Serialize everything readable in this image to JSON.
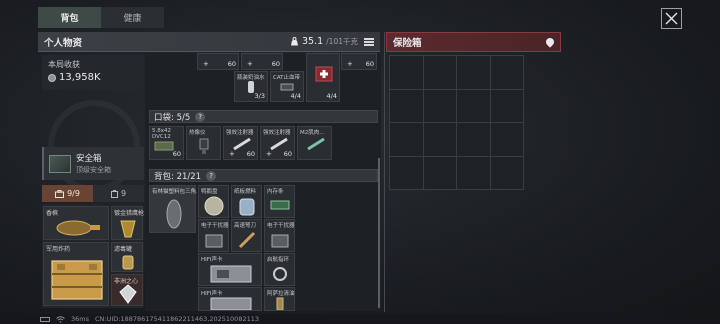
{
  "tabs": [
    {
      "label": "背包",
      "active": true
    },
    {
      "label": "健康",
      "active": false
    }
  ],
  "personal": {
    "title": "个人物资",
    "weight_current": "35.1",
    "weight_max": "/101千克"
  },
  "safe_box_panel": {
    "title": "保险箱"
  },
  "earnings": {
    "label": "本局收获",
    "value": "13,958K"
  },
  "safebox_item": {
    "name": "安全箱",
    "grade": "顶级安全箱"
  },
  "subtabs": [
    {
      "label": "9/9",
      "icon": "toolbox-icon",
      "active": true
    },
    {
      "label": "9",
      "icon": "bag-icon",
      "active": false
    }
  ],
  "equipment": [
    {
      "label": "香槟"
    },
    {
      "label": "镀金猎鹰枪"
    },
    {
      "label": "军用炸药"
    },
    {
      "label": "滤毒罐"
    },
    {
      "label": "非洲之心"
    }
  ],
  "top_items": [
    {
      "plus": "+",
      "count": "60"
    },
    {
      "plus": "+",
      "count": "60"
    },
    {
      "plus": "+",
      "count": "60"
    },
    {
      "name": "瓶装奶油水",
      "count": "3/3"
    },
    {
      "name": "CAT止血带",
      "count": "4/4"
    },
    {
      "name": "",
      "count": "4/4"
    }
  ],
  "pocket": {
    "label": "口袋: 5/5",
    "help": "?",
    "items": [
      {
        "name": "5.8x42\nDVC12",
        "count": "60"
      },
      {
        "name": "热像仪",
        "count": ""
      },
      {
        "name": "强效注射器",
        "plus": "+",
        "count": "60"
      },
      {
        "name": "强效注射器",
        "plus": "+",
        "count": "60"
      },
      {
        "name": "M2肌肉...",
        "count": ""
      }
    ]
  },
  "backpack": {
    "label": "背包: 21/21",
    "help": "?",
    "items": [
      {
        "name": "有林猫塑料包三角..."
      },
      {
        "name": "鸭鹅盘"
      },
      {
        "name": "纸板燃料"
      },
      {
        "name": "内存条"
      },
      {
        "name": "电子干扰器"
      },
      {
        "name": "高速弩刀"
      },
      {
        "name": "电子干扰器"
      },
      {
        "name": "HIFI声卡"
      },
      {
        "name": "启航指环"
      },
      {
        "name": "HIFI声卡"
      },
      {
        "name": "阿萨拉清油"
      }
    ]
  },
  "status_bar": {
    "ping": "36ms",
    "uid": "CN:UID:188786175411862211463,202510082113"
  }
}
